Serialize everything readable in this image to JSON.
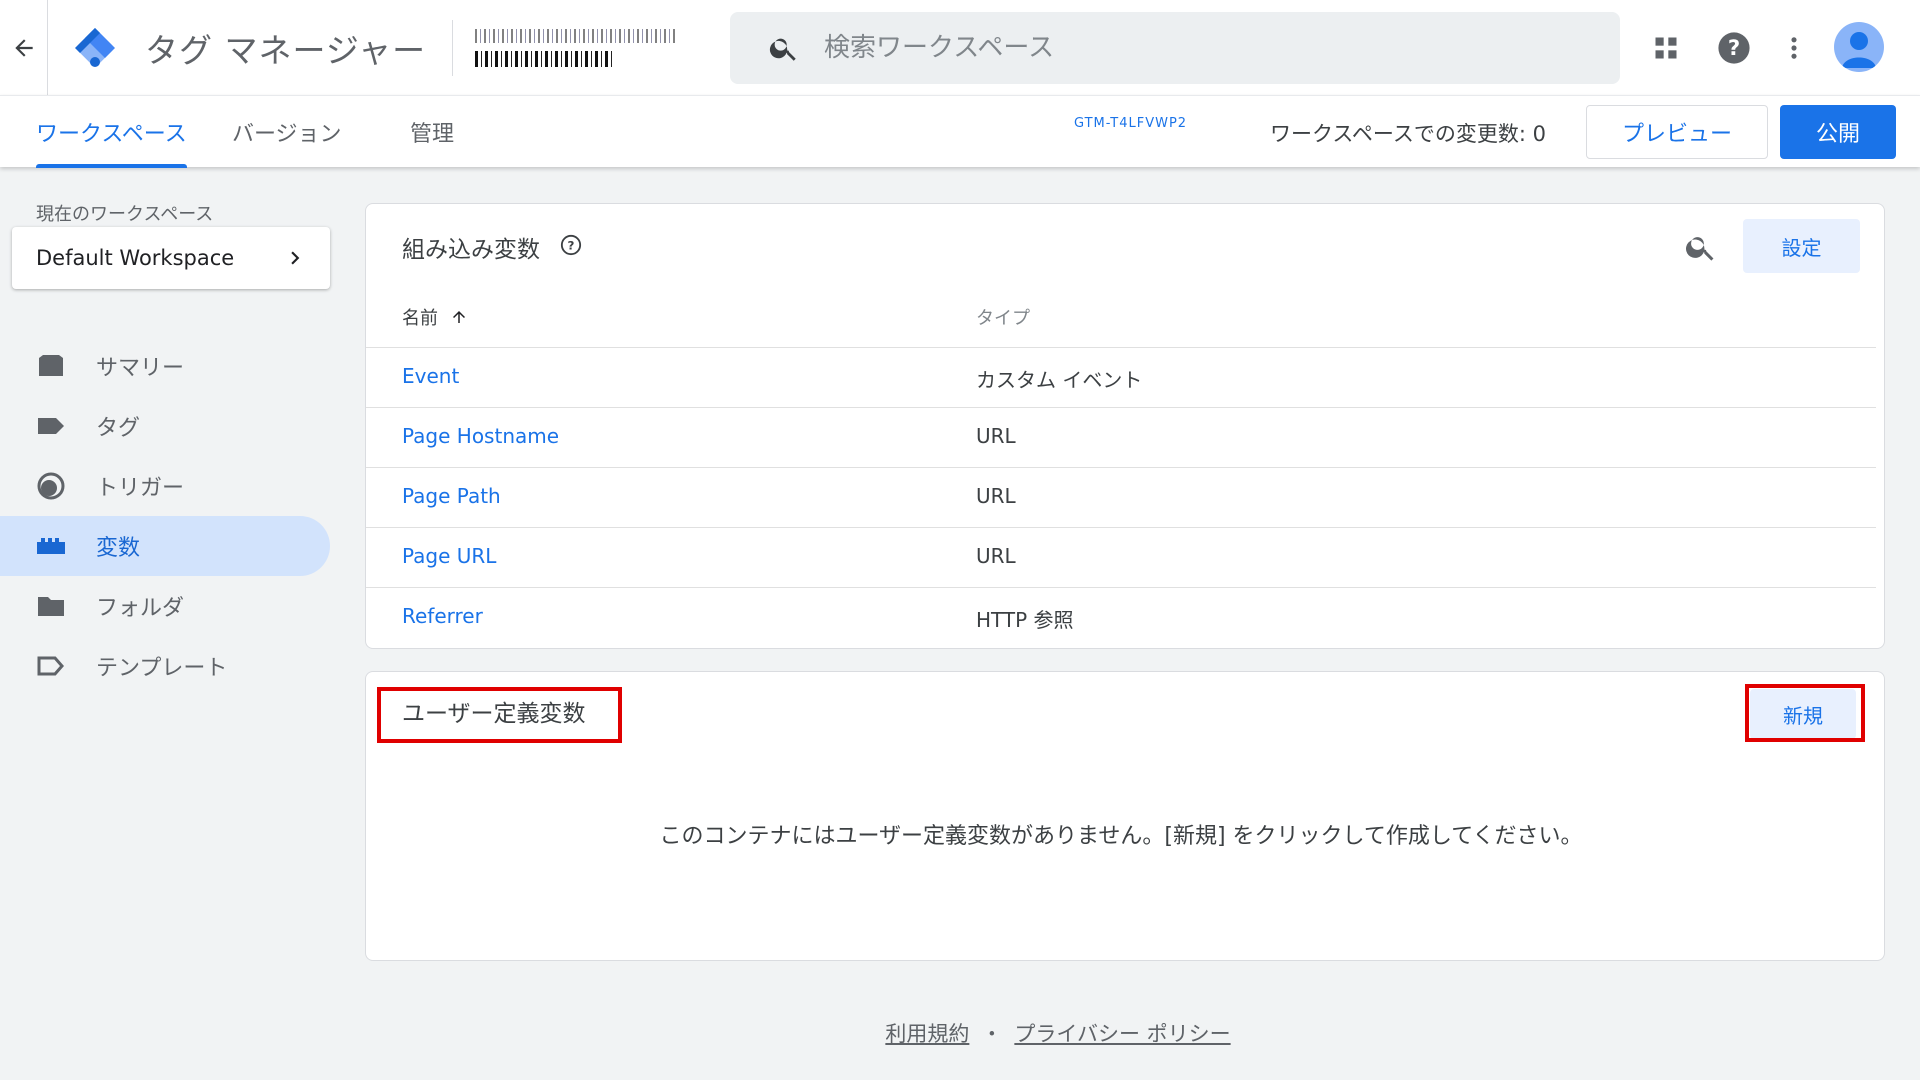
{
  "header": {
    "app_title": "タグ マネージャー",
    "search_placeholder": "検索ワークスペース"
  },
  "subnav": {
    "tabs": [
      {
        "label": "ワークスペース",
        "active": true
      },
      {
        "label": "バージョン",
        "active": false
      },
      {
        "label": "管理",
        "active": false
      }
    ],
    "container_id": "GTM-T4LFVWP2",
    "changes_label": "ワークスペースでの変更数: 0",
    "preview_label": "プレビュー",
    "publish_label": "公開"
  },
  "sidebar": {
    "workspace_label": "現在のワークスペース",
    "workspace_name": "Default Workspace",
    "items": [
      {
        "label": "サマリー",
        "icon": "summary-icon",
        "active": false
      },
      {
        "label": "タグ",
        "icon": "tag-icon",
        "active": false
      },
      {
        "label": "トリガー",
        "icon": "trigger-icon",
        "active": false
      },
      {
        "label": "変数",
        "icon": "variable-icon",
        "active": true
      },
      {
        "label": "フォルダ",
        "icon": "folder-icon",
        "active": false
      },
      {
        "label": "テンプレート",
        "icon": "template-icon",
        "active": false
      }
    ]
  },
  "builtin": {
    "title": "組み込み変数",
    "settings_label": "設定",
    "columns": {
      "name": "名前",
      "type": "タイプ"
    },
    "rows": [
      {
        "name": "Event",
        "type": "カスタム イベント"
      },
      {
        "name": "Page Hostname",
        "type": "URL"
      },
      {
        "name": "Page Path",
        "type": "URL"
      },
      {
        "name": "Page URL",
        "type": "URL"
      },
      {
        "name": "Referrer",
        "type": "HTTP 参照"
      }
    ]
  },
  "user_defined": {
    "title": "ユーザー定義変数",
    "new_label": "新規",
    "empty_message": "このコンテナにはユーザー定義変数がありません。[新規] をクリックして作成してください。"
  },
  "footer": {
    "terms": "利用規約",
    "separator": "・",
    "privacy": "プライバシー ポリシー"
  },
  "colors": {
    "accent": "#1a73e8",
    "highlight": "#e00000",
    "active_nav_bg": "#d2e3fc"
  }
}
